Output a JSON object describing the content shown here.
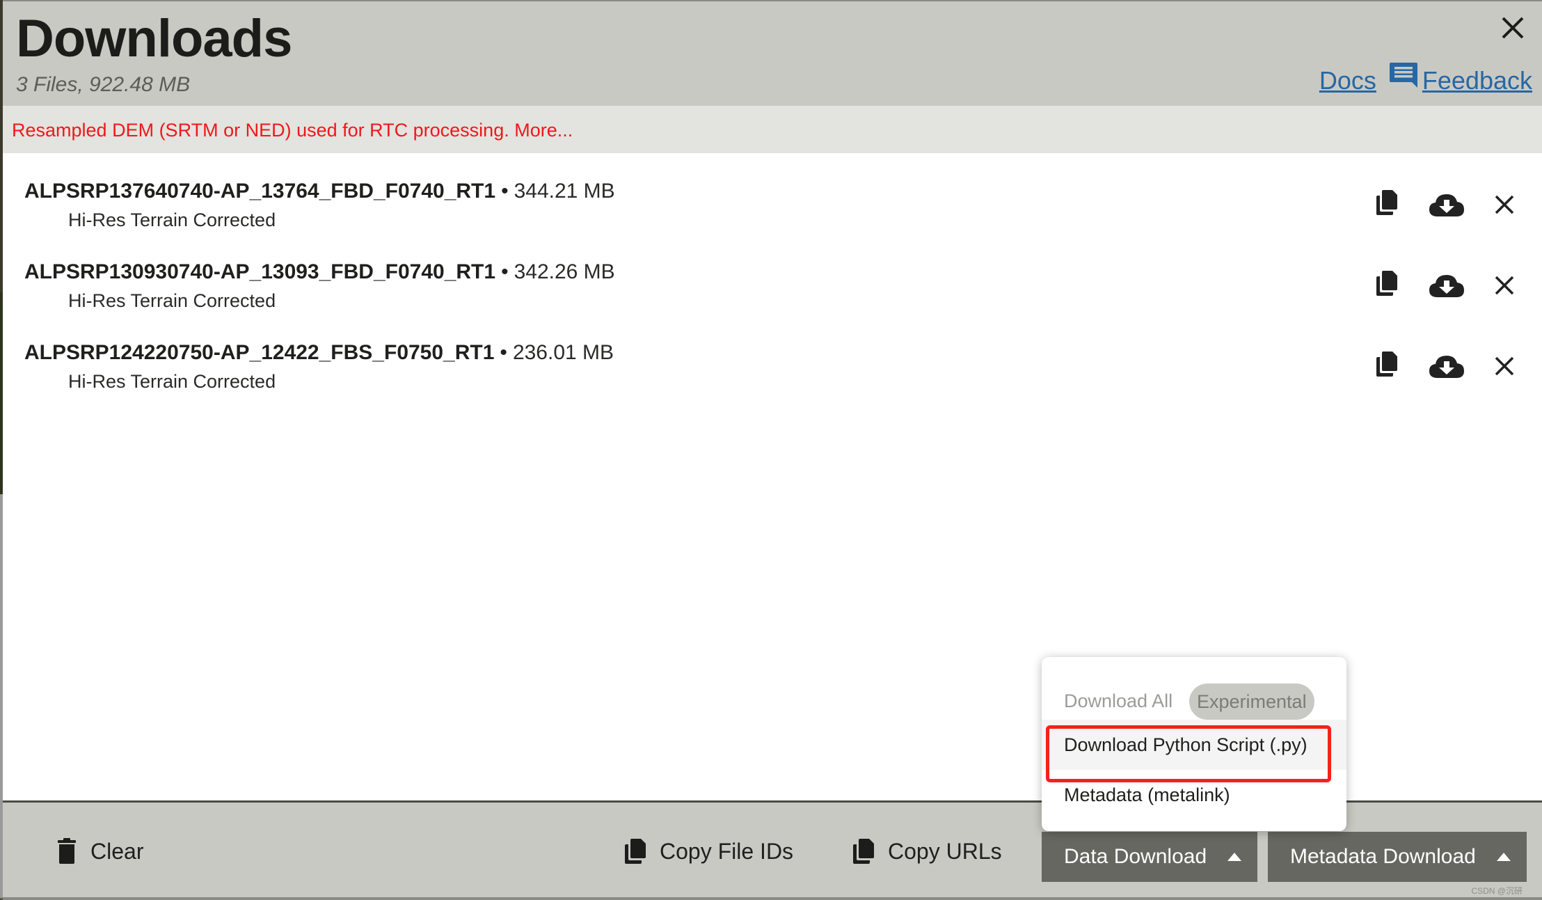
{
  "dialog": {
    "title": "Downloads",
    "summary": "3 Files, 922.48 MB",
    "links": {
      "docs": "Docs",
      "feedback": "Feedback"
    },
    "notice": "Resampled DEM (SRTM or NED) used for RTC processing. More..."
  },
  "files": [
    {
      "name": "ALPSRP137640740-AP_13764_FBD_F0740_RT1",
      "separator": "•",
      "size": "344.21 MB",
      "type": "Hi-Res Terrain Corrected"
    },
    {
      "name": "ALPSRP130930740-AP_13093_FBD_F0740_RT1",
      "separator": "•",
      "size": "342.26 MB",
      "type": "Hi-Res Terrain Corrected"
    },
    {
      "name": "ALPSRP124220750-AP_12422_FBS_F0750_RT1",
      "separator": "•",
      "size": "236.01 MB",
      "type": "Hi-Res Terrain Corrected"
    }
  ],
  "row_icons": [
    "copy-icon",
    "cloud-download-icon",
    "remove-icon"
  ],
  "footer": {
    "clear": "Clear",
    "copy_file_ids": "Copy File IDs",
    "copy_urls": "Copy URLs",
    "data_download": "Data Download",
    "metadata_download": "Metadata Download"
  },
  "data_download_menu": {
    "header": "Download All",
    "badge": "Experimental",
    "items": [
      "Download Python Script (.py)",
      "Metadata (metalink)"
    ]
  },
  "watermark": "CSDN @沉研",
  "colors": {
    "header_bg": "#c9c9c3",
    "link": "#2767a3",
    "notice": "#f0171a",
    "button_bg": "#666760",
    "annotation": "#f5211c"
  }
}
